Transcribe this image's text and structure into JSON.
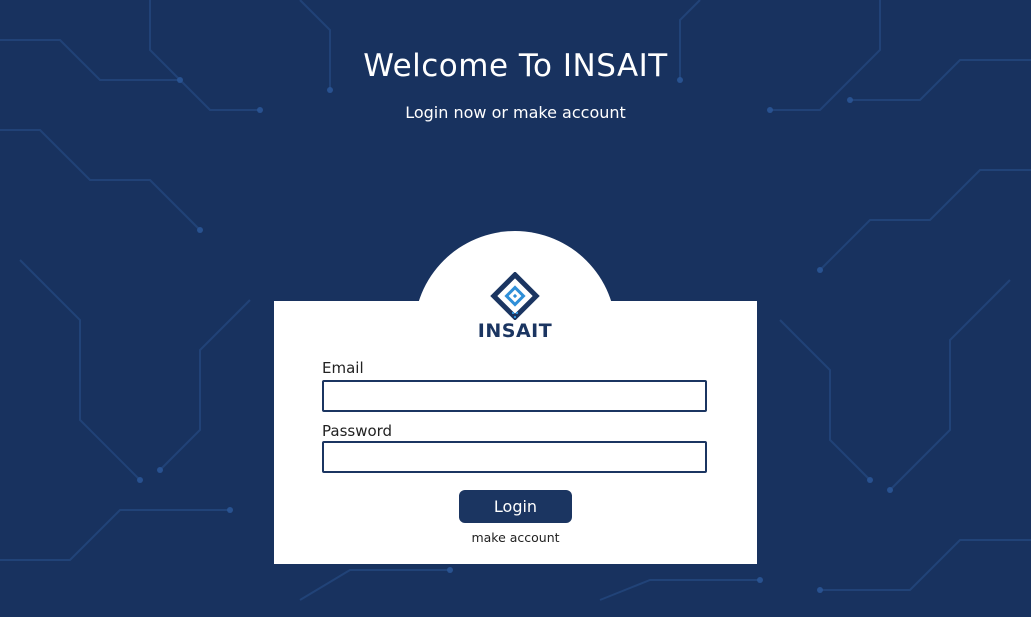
{
  "page": {
    "title": "Welcome To INSAIT",
    "subtitle": "Login now or make account"
  },
  "logo": {
    "text": "INSAIT",
    "icon": "insait-logo-icon"
  },
  "form": {
    "email_label": "Email",
    "email_value": "",
    "password_label": "Password",
    "password_value": "",
    "login_label": "Login",
    "make_account_label": "make account"
  },
  "colors": {
    "background": "#18325f",
    "primary": "#1b3561",
    "card": "#ffffff",
    "accent": "#2f8fd8"
  }
}
